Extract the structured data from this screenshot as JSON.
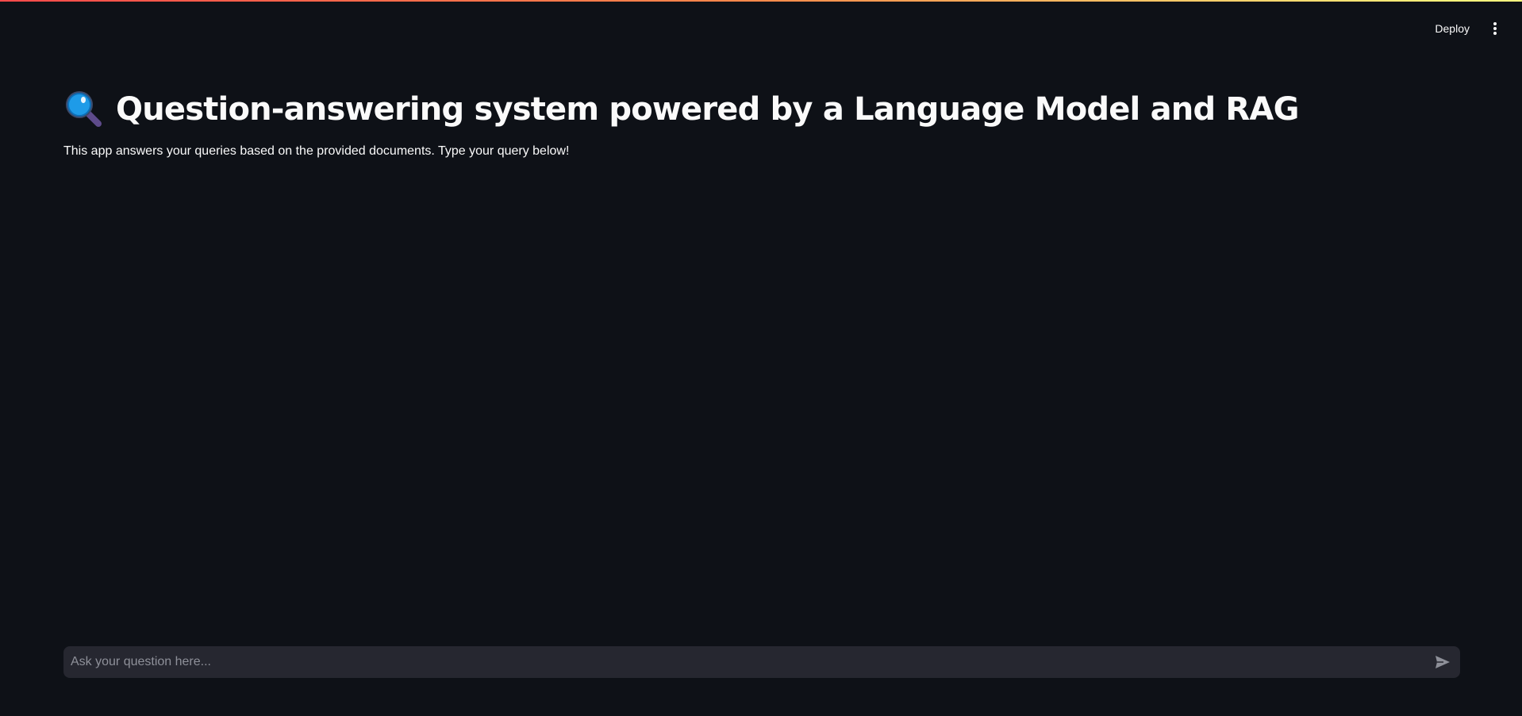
{
  "header": {
    "deploy_label": "Deploy",
    "menu_icon": "more-vertical-icon"
  },
  "main": {
    "title_icon": "magnifying-glass-icon",
    "title": "Question-answering system powered by a Language Model and RAG",
    "description": "This app answers your queries based on the provided documents. Type your query below!"
  },
  "chat": {
    "placeholder": "Ask your question here...",
    "value": "",
    "send_icon": "send-icon"
  },
  "colors": {
    "background": "#0e1117",
    "input_background": "#262730",
    "text": "#fafafa",
    "placeholder": "#8e9099",
    "accent_gradient_start": "#ff4b4b",
    "accent_gradient_end": "#fffd80"
  }
}
